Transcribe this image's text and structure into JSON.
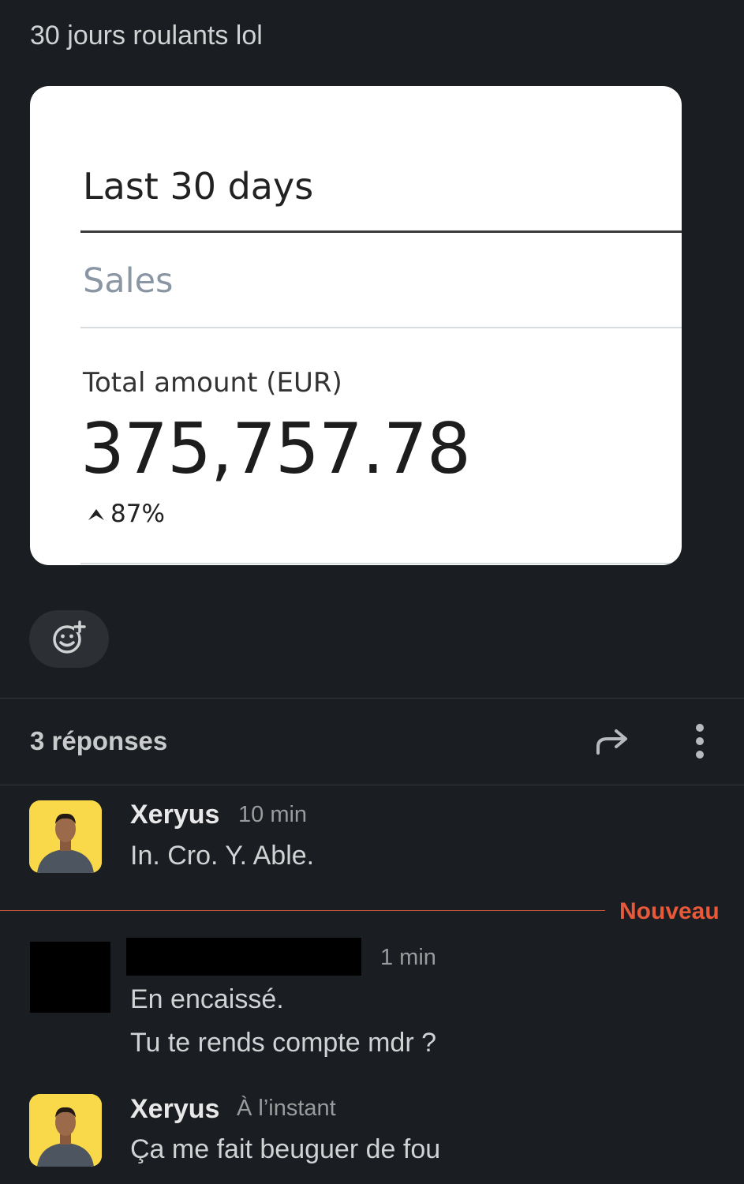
{
  "message": {
    "text": "30 jours roulants lol"
  },
  "card": {
    "title": "Last 30 days",
    "tab": "Sales",
    "total_label": "Total amount (EUR)",
    "amount": "375,757.78",
    "change": "87%",
    "change_icon": "up-arrow-icon"
  },
  "reaction": {
    "icon": "add-reaction-icon"
  },
  "thread": {
    "replies_label": "3 réponses",
    "new_label": "Nouveau",
    "messages": [
      {
        "author": "Xeryus",
        "time": "10 min",
        "lines": [
          "In. Cro. Y. Able."
        ]
      },
      {
        "author": "",
        "time": "1 min",
        "lines": [
          "En encaissé.",
          "Tu te rends compte mdr ?"
        ]
      },
      {
        "author": "Xeryus",
        "time": "À l’instant",
        "lines": [
          "Ça me fait beuguer de fou"
        ]
      }
    ]
  },
  "colors": {
    "background": "#1a1d21",
    "new_accent": "#e8593a",
    "avatar_bg": "#f9d84a"
  }
}
